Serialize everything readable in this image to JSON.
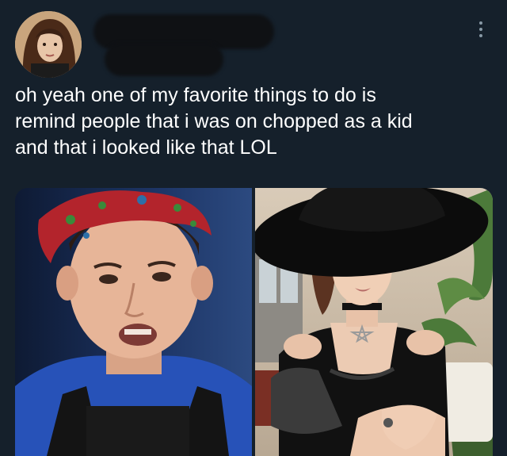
{
  "tweet": {
    "text": "oh yeah one of my favorite things to do is\nremind people that i was on chopped as a kid\nand that i looked like that LOL"
  },
  "header": {
    "more_icon": "more-horizontal-icon"
  },
  "colors": {
    "background": "#15202b",
    "text": "#ffffff",
    "icon": "#8899a6"
  }
}
